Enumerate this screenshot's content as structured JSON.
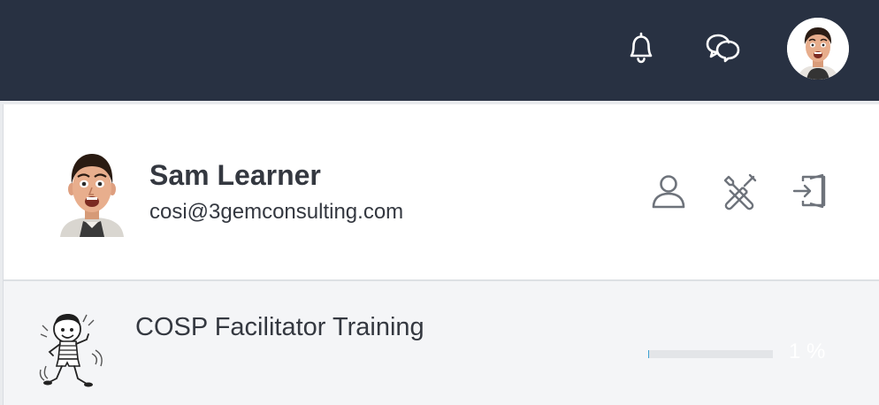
{
  "topbar": {
    "background": "#283142",
    "icons": {
      "notifications": "bell-icon",
      "messages": "chat-bubbles-icon",
      "account": "user-avatar"
    }
  },
  "user": {
    "name": "Sam Learner",
    "email": "cosi@3gemconsulting.com",
    "actions": [
      {
        "name": "profile",
        "icon": "person-icon"
      },
      {
        "name": "settings",
        "icon": "wrench-screwdriver-icon"
      },
      {
        "name": "logout",
        "icon": "exit-door-icon"
      }
    ]
  },
  "course": {
    "title": "COSP Facilitator Training",
    "progress_value": 1,
    "progress_text": "1 %",
    "progress_color": "#3ea2d3"
  }
}
